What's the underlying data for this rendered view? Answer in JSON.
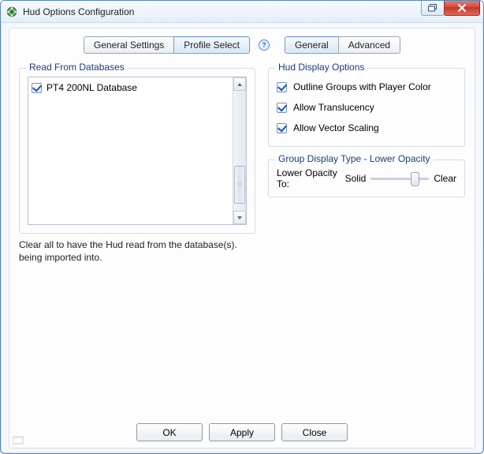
{
  "window": {
    "title": "Hud Options Configuration"
  },
  "tabs": {
    "left": [
      {
        "label": "General Settings",
        "active": false
      },
      {
        "label": "Profile Select",
        "active": true
      }
    ],
    "right": [
      {
        "label": "General",
        "active": true
      },
      {
        "label": "Advanced",
        "active": false
      }
    ]
  },
  "databases": {
    "legend": "Read From Databases",
    "items": [
      {
        "label": "PT4 200NL Database",
        "checked": true
      }
    ],
    "hint": "Clear all to have the Hud read from the database(s). being imported into."
  },
  "display_options": {
    "legend": "Hud Display Options",
    "items": [
      {
        "label": "Outline Groups with Player Color",
        "checked": true
      },
      {
        "label": "Allow Translucency",
        "checked": true
      },
      {
        "label": "Allow Vector Scaling",
        "checked": true
      }
    ]
  },
  "opacity_group": {
    "legend": "Group Display Type - Lower Opacity",
    "label": "Lower Opacity To:",
    "left_label": "Solid",
    "right_label": "Clear"
  },
  "buttons": {
    "ok": "OK",
    "apply": "Apply",
    "close": "Close"
  },
  "icons": {
    "app": "app-icon",
    "help": "help-icon",
    "restore": "restore-icon",
    "close": "close-icon",
    "up": "arrow-up-icon",
    "down": "arrow-down-icon",
    "grip": "status-grip-icon"
  }
}
